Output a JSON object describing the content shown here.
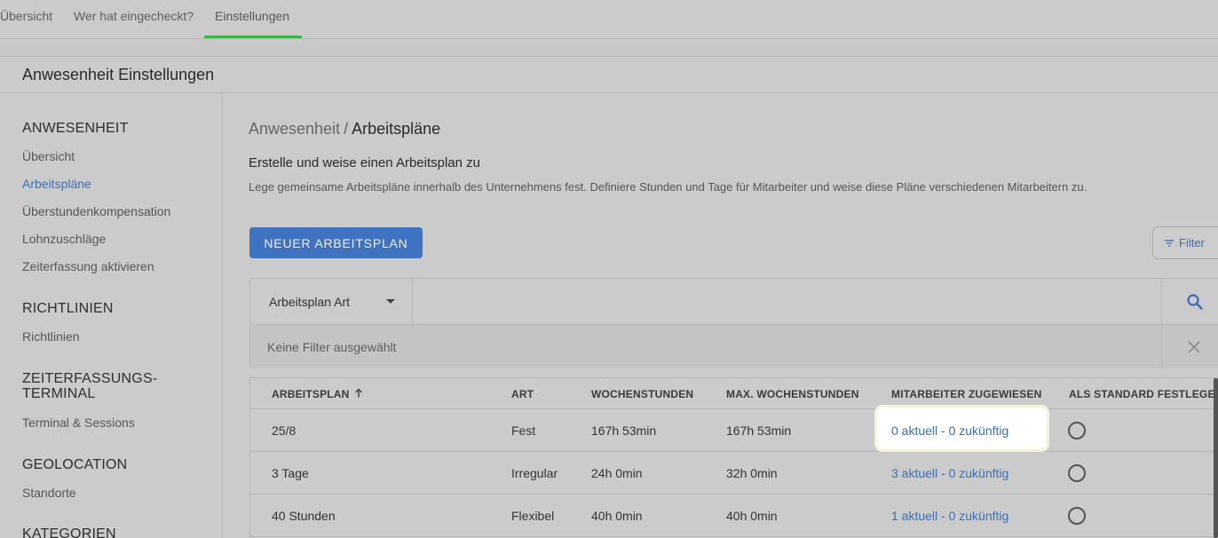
{
  "tabs": {
    "overview": "Übersicht",
    "checked_in": "Wer hat eingecheckt?",
    "settings": "Einstellungen"
  },
  "page": {
    "title": "Anwesenheit Einstellungen"
  },
  "sidebar": {
    "sections": [
      {
        "heading": "ANWESENHEIT",
        "items": [
          "Übersicht",
          "Arbeitspläne",
          "Überstundenkompensation",
          "Lohnzuschläge",
          "Zeiterfassung aktivieren"
        ]
      },
      {
        "heading": "RICHTLINIEN",
        "items": [
          "Richtlinien"
        ]
      },
      {
        "heading_line1": "ZEITERFASSUNGS-",
        "heading_line2": "TERMINAL",
        "items": [
          "Terminal & Sessions"
        ]
      },
      {
        "heading": "GEOLOCATION",
        "items": [
          "Standorte"
        ]
      },
      {
        "heading": "KATEGORIEN"
      }
    ],
    "active_item": "Arbeitspläne"
  },
  "main": {
    "breadcrumb": {
      "parent": "Anwesenheit",
      "separator": "/",
      "current": "Arbeitspläne"
    },
    "section_title": "Erstelle und weise einen Arbeitsplan zu",
    "section_desc": "Lege gemeinsame Arbeitspläne innerhalb des Unternehmens fest. Definiere Stunden und Tage für Mitarbeiter und weise diese Pläne verschiedenen Mitarbeitern zu.",
    "new_button": "NEUER ARBEITSPLAN",
    "filter_button": "Filter"
  },
  "filter": {
    "type_select": "Arbeitsplan Art",
    "search_value": "",
    "no_filter_text": "Keine Filter ausgewählt"
  },
  "table": {
    "headers": [
      "ARBEITSPLAN",
      "ART",
      "WOCHENSTUNDEN",
      "MAX. WOCHENSTUNDEN",
      "MITARBEITER ZUGEWIESEN",
      "ALS STANDARD FESTLEGEN"
    ],
    "rows": [
      {
        "name": "25/8",
        "type": "Fest",
        "hours": "167h 53min",
        "max_hours": "167h 53min",
        "assigned": "0 aktuell - 0 zukünftig"
      },
      {
        "name": "3 Tage",
        "type": "Irregular",
        "hours": "24h 0min",
        "max_hours": "32h 0min",
        "assigned": "3 aktuell - 0 zukünftig"
      },
      {
        "name": "40 Stunden",
        "type": "Flexibel",
        "hours": "40h 0min",
        "max_hours": "40h 0min",
        "assigned": "1 aktuell - 0 zukünftig"
      }
    ]
  },
  "icons": {
    "sort": "arrow-up-icon",
    "search": "search-icon",
    "clear": "close-icon",
    "filter": "filter-lines-icon",
    "caret": "caret-down-icon"
  },
  "colors": {
    "accent_blue": "#3f72c0",
    "link_blue": "#3a6fb8",
    "active_tab_underline": "#3fb24b"
  }
}
